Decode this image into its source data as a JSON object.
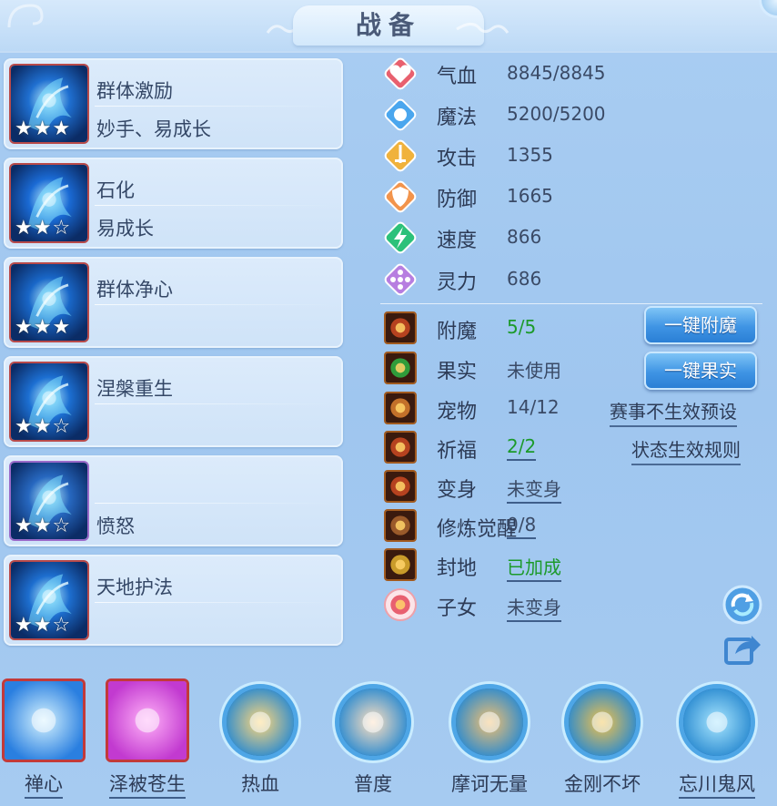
{
  "title": "战备",
  "pet_skills": [
    {
      "line1": "群体激励",
      "line2": "妙手、易成长",
      "stars": 3,
      "frame": "red"
    },
    {
      "line1": "石化",
      "line2": "易成长",
      "stars": 2,
      "frame": "red"
    },
    {
      "line1": "群体净心",
      "line2": "",
      "stars": 3,
      "frame": "red"
    },
    {
      "line1": "涅槃重生",
      "line2": "",
      "stars": 2,
      "frame": "red"
    },
    {
      "line1": "",
      "line2": "愤怒",
      "stars": 2,
      "frame": "purple"
    },
    {
      "line1": "天地护法",
      "line2": "",
      "stars": 2,
      "frame": "red"
    }
  ],
  "attributes": [
    {
      "label": "气血",
      "value": "8845/8845",
      "icon": "heart-icon",
      "color": "#e8606e"
    },
    {
      "label": "魔法",
      "value": "5200/5200",
      "icon": "mana-icon",
      "color": "#4aa6ee"
    },
    {
      "label": "攻击",
      "value": "1355",
      "icon": "sword-icon",
      "color": "#f0b23c"
    },
    {
      "label": "防御",
      "value": "1665",
      "icon": "shield-icon",
      "color": "#f2944c"
    },
    {
      "label": "速度",
      "value": "866",
      "icon": "lightning-icon",
      "color": "#2cc17a"
    },
    {
      "label": "灵力",
      "value": "686",
      "icon": "spirit-icon",
      "color": "#b77ee0"
    }
  ],
  "status": [
    {
      "label": "附魔",
      "value": "5/5",
      "green": true,
      "underline": false,
      "icon": "enchant-icon"
    },
    {
      "label": "果实",
      "value": "未使用",
      "green": false,
      "underline": false,
      "icon": "fruit-icon"
    },
    {
      "label": "宠物",
      "value": "14/12",
      "green": false,
      "underline": false,
      "icon": "pet-icon"
    },
    {
      "label": "祈福",
      "value": "2/2",
      "green": true,
      "underline": true,
      "icon": "blessing-icon"
    },
    {
      "label": "变身",
      "value": "未变身",
      "green": false,
      "underline": true,
      "icon": "transform-icon"
    },
    {
      "label": "修炼觉醒",
      "value": "0/8",
      "green": false,
      "underline": true,
      "icon": "cultivation-icon"
    },
    {
      "label": "封地",
      "value": "已加成",
      "green": true,
      "underline": true,
      "icon": "fief-icon"
    },
    {
      "label": "子女",
      "value": "未变身",
      "green": false,
      "underline": true,
      "icon": "child-icon"
    }
  ],
  "buttons": {
    "one_click_enchant": "一键附魔",
    "one_click_fruit": "一键果实",
    "event_preset": "赛事不生效预设",
    "status_rules": "状态生效规则"
  },
  "bottom_skills": [
    {
      "label": "禅心",
      "frame": "square",
      "underline": true,
      "icon": "zen-icon"
    },
    {
      "label": "泽被苍生",
      "frame": "square",
      "underline": true,
      "icon": "palm-icon"
    },
    {
      "label": "热血",
      "frame": "round",
      "underline": false,
      "icon": "hotblood-icon"
    },
    {
      "label": "普度",
      "frame": "round",
      "underline": false,
      "icon": "hand-icon"
    },
    {
      "label": "摩诃无量",
      "frame": "round",
      "underline": false,
      "icon": "monk-icon"
    },
    {
      "label": "金刚不坏",
      "frame": "round",
      "underline": false,
      "icon": "vajra-icon"
    },
    {
      "label": "忘川鬼风",
      "frame": "round",
      "underline": true,
      "icon": "ghostwind-icon"
    }
  ]
}
